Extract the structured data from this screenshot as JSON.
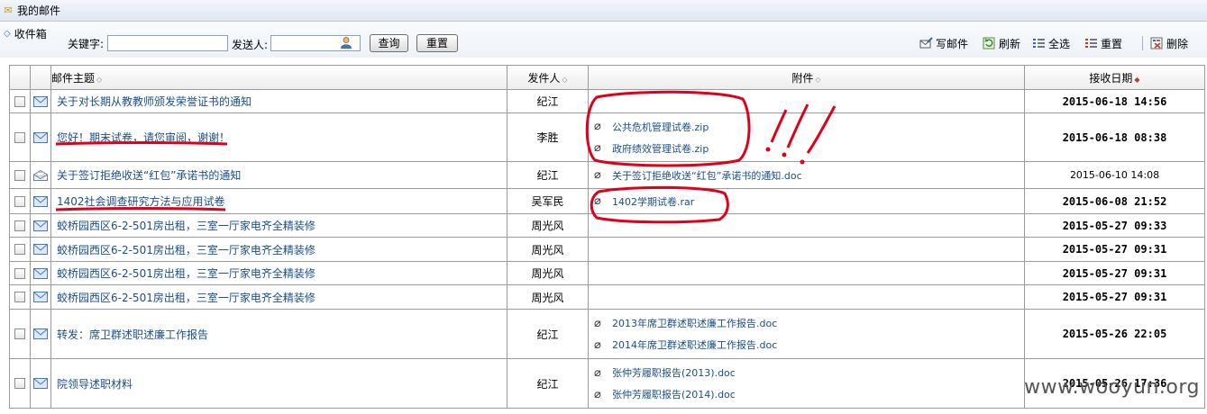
{
  "window": {
    "title": "我的邮件"
  },
  "tab": {
    "label": "收件箱"
  },
  "search": {
    "keyword_label": "关键字:",
    "keyword_value": "",
    "sender_label": "发送人:",
    "sender_value": "",
    "query_button": "查询",
    "reset_button": "重置"
  },
  "toolbar": {
    "compose": "写邮件",
    "refresh": "刷新",
    "select_all": "全选",
    "reset": "重置",
    "delete": "删除"
  },
  "columns": {
    "subject": "邮件主题",
    "sender": "发件人",
    "attachment": "附件",
    "date": "接收日期"
  },
  "rows": [
    {
      "subject": "关于对长期从教教师颁发荣誉证书的通知",
      "sender": "纪江",
      "attachments": [],
      "date": "2015-06-18 14:56",
      "unread": true,
      "icon": "envelope-icon"
    },
    {
      "subject": "您好！期末试卷，请您审阅，谢谢！",
      "sender": "李胜",
      "attachments": [
        "公共危机管理试卷.zip",
        "政府绩效管理试卷.zip"
      ],
      "date": "2015-06-18 08:38",
      "unread": true,
      "icon": "envelope-icon"
    },
    {
      "subject": "关于签订拒绝收送“红包”承诺书的通知",
      "sender": "纪江",
      "attachments": [
        "关于签订拒绝收送“红包”承诺书的通知.doc"
      ],
      "date": "2015-06-10 14:08",
      "unread": false,
      "icon": "open-envelope-icon"
    },
    {
      "subject": "1402社会调查研究方法与应用试卷",
      "sender": "吴军民",
      "attachments": [
        "1402学期试卷.rar"
      ],
      "date": "2015-06-08 21:52",
      "unread": true,
      "icon": "envelope-icon"
    },
    {
      "subject": "蛟桥园西区6-2-501房出租，三室一厅家电齐全精装修",
      "sender": "周光风",
      "attachments": [],
      "date": "2015-05-27 09:33",
      "unread": true,
      "icon": "envelope-icon"
    },
    {
      "subject": "蛟桥园西区6-2-501房出租，三室一厅家电齐全精装修",
      "sender": "周光风",
      "attachments": [],
      "date": "2015-05-27 09:31",
      "unread": true,
      "icon": "envelope-icon"
    },
    {
      "subject": "蛟桥园西区6-2-501房出租，三室一厅家电齐全精装修",
      "sender": "周光风",
      "attachments": [],
      "date": "2015-05-27 09:31",
      "unread": true,
      "icon": "envelope-icon"
    },
    {
      "subject": "蛟桥园西区6-2-501房出租，三室一厅家电齐全精装修",
      "sender": "周光风",
      "attachments": [],
      "date": "2015-05-27 09:31",
      "unread": true,
      "icon": "envelope-icon"
    },
    {
      "subject": "转发：席卫群述职述廉工作报告",
      "sender": "纪江",
      "attachments": [
        "2013年席卫群述职述廉工作报告.doc",
        "2014年席卫群述职述廉工作报告.doc"
      ],
      "date": "2015-05-26 22:05",
      "unread": true,
      "icon": "envelope-icon"
    },
    {
      "subject": "院领导述职材料",
      "sender": "纪江",
      "attachments": [
        "张仲芳履职报告(2013).doc",
        "张仲芳履职报告(2014).doc"
      ],
      "date": "2015-05-26 17:36",
      "unread": true,
      "icon": "envelope-icon"
    }
  ],
  "watermark": "www.wooyun.org",
  "colors": {
    "link": "#1a4f8a",
    "annotation": "#e0001b"
  }
}
